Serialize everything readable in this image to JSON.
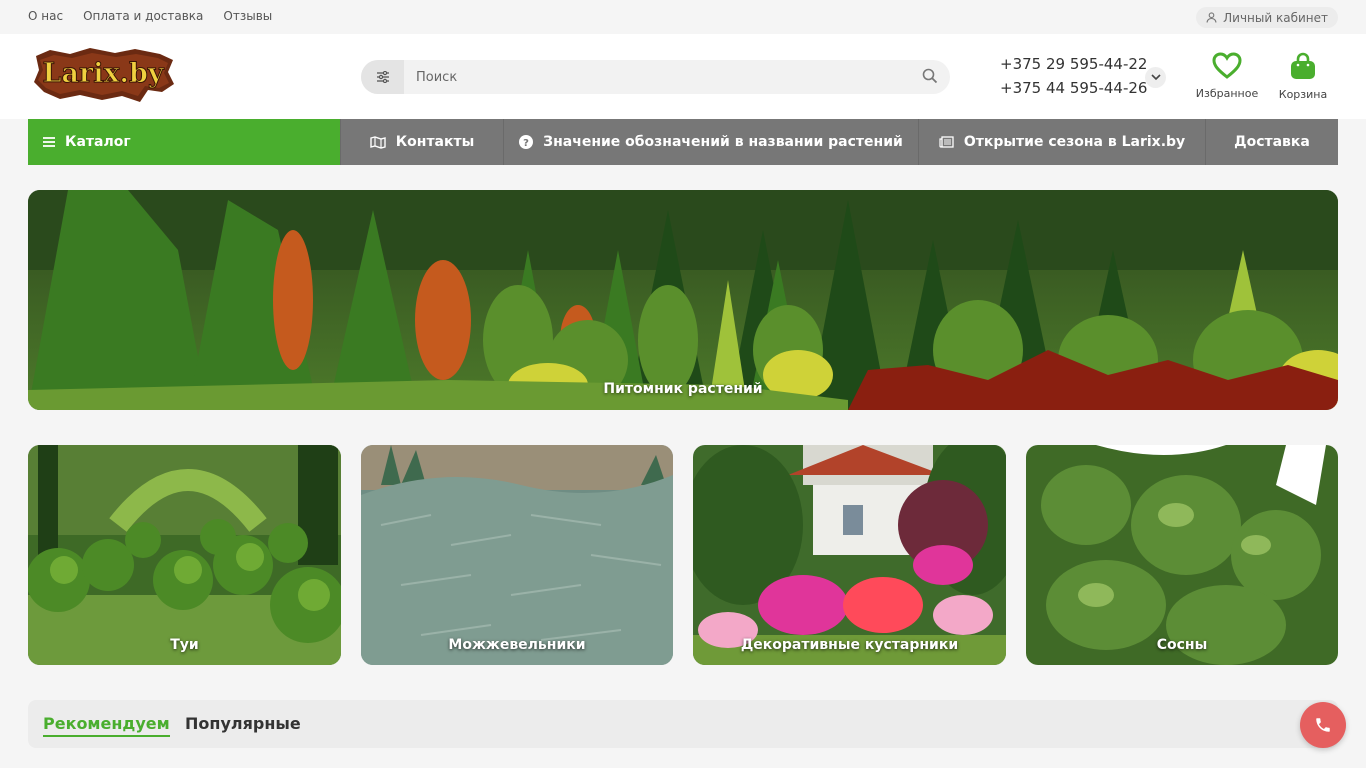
{
  "topbar": {
    "links": [
      "О нас",
      "Оплата и доставка",
      "Отзывы"
    ],
    "cabinet_label": "Личный кабинет"
  },
  "header": {
    "logo_text": "Larix.by",
    "search_placeholder": "Поиск",
    "phones": [
      "+375 29 595-44-22",
      "+375 44 595-44-26"
    ],
    "favorites_label": "Избранное",
    "cart_label": "Корзина"
  },
  "nav": {
    "catalog": "Каталог",
    "contacts": "Контакты",
    "meaning": "Значение обозначений в названии растений",
    "season": "Открытие сезона в Larix.by",
    "delivery": "Доставка"
  },
  "hero": {
    "caption": "Питомник растений"
  },
  "categories": [
    {
      "label": "Туи"
    },
    {
      "label": "Можжевельники"
    },
    {
      "label": "Декоративные кустарники"
    },
    {
      "label": "Сосны"
    }
  ],
  "tabs": [
    "Рекомендуем",
    "Популярные"
  ],
  "colors": {
    "accent": "#4aae2e",
    "nav_bg": "#777777",
    "call_button": "#e55f5f"
  }
}
